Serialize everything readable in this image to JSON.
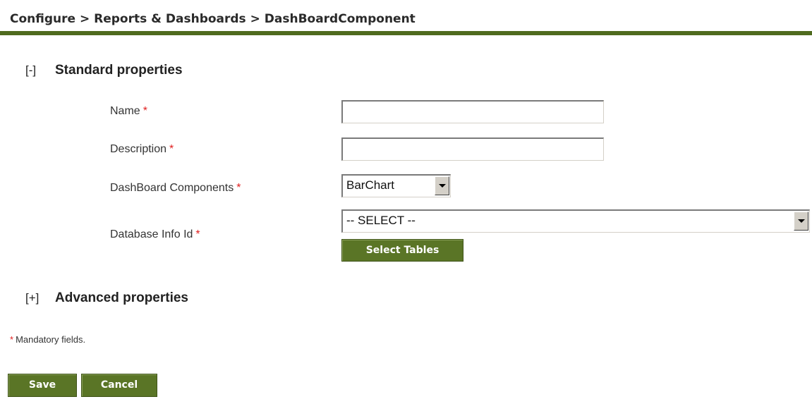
{
  "breadcrumb": {
    "text": "Configure > Reports & Dashboards > DashBoardComponent"
  },
  "standard_section": {
    "toggle": "[-]",
    "title": "Standard properties"
  },
  "fields": {
    "name": {
      "label": "Name",
      "required_mark": "*",
      "value": ""
    },
    "description": {
      "label": "Description",
      "required_mark": "*",
      "value": ""
    },
    "dashboard_components": {
      "label": "DashBoard Components",
      "required_mark": "*",
      "selected": "BarChart"
    },
    "database_info_id": {
      "label": "Database Info Id",
      "required_mark": "*",
      "selected": "-- SELECT --"
    }
  },
  "select_tables_button": "Select Tables",
  "advanced_section": {
    "toggle": "[+]",
    "title": "Advanced properties"
  },
  "mandatory_note": {
    "mark": "*",
    "text": "Mandatory fields."
  },
  "actions": {
    "save_label": "Save",
    "cancel_label": "Cancel"
  },
  "colors": {
    "accent_green": "#5a7526",
    "required_red": "#e02020"
  }
}
